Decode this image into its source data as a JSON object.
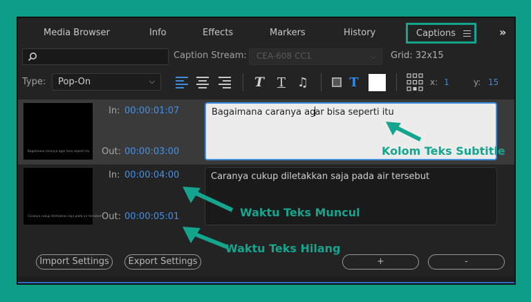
{
  "tabs": [
    "Media Browser",
    "Info",
    "Effects",
    "Markers",
    "History",
    "Captions"
  ],
  "overflow_label": "»",
  "search": {
    "value": "",
    "icon": "search-icon"
  },
  "caption_stream": {
    "label": "Caption Stream:",
    "value": "CEA-608 CC1"
  },
  "grid": {
    "label": "Grid:",
    "value": "32x15"
  },
  "type": {
    "label": "Type:",
    "value": "Pop-On"
  },
  "format": {
    "italic": "T",
    "underline": "T",
    "music": "♫",
    "text_color_t": "T",
    "x_label": "x:",
    "x_value": "1",
    "y_label": "y:",
    "y_value": "15",
    "accent_color": "#3d8de3",
    "swatch_color": "#ffffff"
  },
  "captions": [
    {
      "in_label": "In:",
      "in_time": "00:00:01:07",
      "out_label": "Out:",
      "out_time": "00:00:03:00",
      "text_before": "Bagaimana caranya ag",
      "text_after": "ar bisa seperti itu"
    },
    {
      "in_label": "In:",
      "in_time": "00:00:04:00",
      "out_label": "Out:",
      "out_time": "00:00:05:01",
      "text": "Caranya cukup diletakkan saja pada air tersebut"
    }
  ],
  "annotations": {
    "subtitle_column": "Kolom Teks Subtitle",
    "time_appear": "Waktu Teks Muncul",
    "time_disappear": "Waktu Teks Hilang",
    "color": "#13a58d"
  },
  "buttons": {
    "import": "Import Settings",
    "export": "Export Settings",
    "add": "+",
    "remove": "-"
  }
}
